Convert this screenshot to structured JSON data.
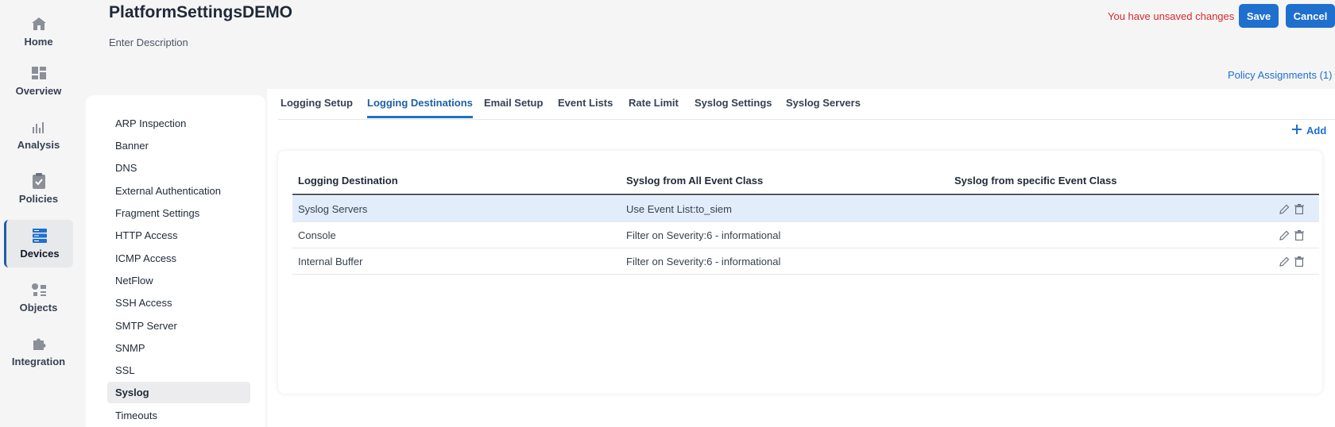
{
  "nav": {
    "items": [
      {
        "label": "Home",
        "icon": "home-icon"
      },
      {
        "label": "Overview",
        "icon": "dashboard-icon"
      },
      {
        "label": "Analysis",
        "icon": "bar-chart-icon"
      },
      {
        "label": "Policies",
        "icon": "clipboard-check-icon"
      },
      {
        "label": "Devices",
        "icon": "server-icon",
        "active": true
      },
      {
        "label": "Objects",
        "icon": "shapes-icon"
      },
      {
        "label": "Integration",
        "icon": "puzzle-icon"
      }
    ]
  },
  "header": {
    "title": "PlatformSettingsDEMO",
    "description": "Enter Description",
    "unsaved_text": "You have unsaved changes",
    "save_label": "Save",
    "cancel_label": "Cancel",
    "policy_assignments": "Policy Assignments (1)"
  },
  "sidelist": {
    "items": [
      "ARP Inspection",
      "Banner",
      "DNS",
      "External Authentication",
      "Fragment Settings",
      "HTTP Access",
      "ICMP Access",
      "NetFlow",
      "SSH Access",
      "SMTP Server",
      "SNMP",
      "SSL",
      "Syslog",
      "Timeouts"
    ],
    "active": "Syslog"
  },
  "tabs": {
    "items": [
      "Logging Setup",
      "Logging Destinations",
      "Email Setup",
      "Event Lists",
      "Rate Limit",
      "Syslog Settings",
      "Syslog Servers"
    ],
    "active": "Logging Destinations"
  },
  "add_label": "Add",
  "table": {
    "columns": [
      "Logging Destination",
      "Syslog from All Event Class",
      "Syslog from specific Event Class"
    ],
    "rows": [
      {
        "destination": "Syslog Servers",
        "all_event_class": "Use Event List:to_siem",
        "specific_event_class": "",
        "highlighted": true
      },
      {
        "destination": "Console",
        "all_event_class": "Filter on Severity:6 - informational",
        "specific_event_class": ""
      },
      {
        "destination": "Internal Buffer",
        "all_event_class": "Filter on Severity:6 - informational",
        "specific_event_class": ""
      }
    ]
  },
  "colors": {
    "accent": "#1f6fce",
    "warning_text": "#d9292d",
    "row_highlight": "#e1edfb"
  }
}
